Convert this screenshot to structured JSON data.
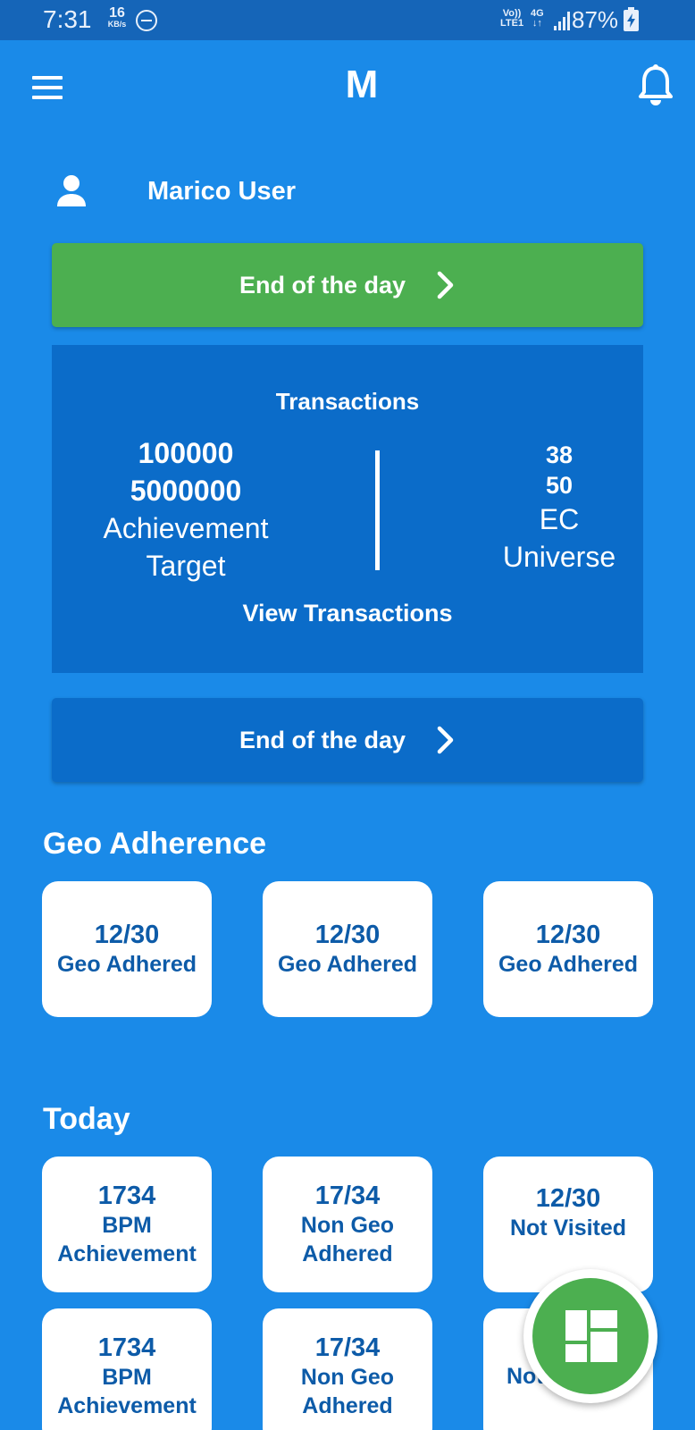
{
  "status_bar": {
    "time": "7:31",
    "speed_value": "16",
    "speed_unit": "KB/s",
    "volte_line1": "Vo))",
    "volte_line2": "LTE1",
    "network_line1": "4G",
    "network_line2": "↓↑",
    "battery": "87%",
    "icons": [
      "do-not-disturb-icon",
      "signal-icon",
      "battery-charging-icon"
    ]
  },
  "app_bar": {
    "logo": "M",
    "icons": [
      "menu-icon",
      "bell-icon"
    ]
  },
  "user": {
    "name": "Marico User",
    "icon": "user-icon"
  },
  "end_of_day_primary": {
    "label": "End of the day",
    "icon": "chevron-right-icon",
    "color": "#4caf50"
  },
  "transactions": {
    "title": "Transactions",
    "achievement_value": "100000",
    "target_value": "5000000",
    "achievement_label": "Achievement",
    "target_label": "Target",
    "ec_value": "38",
    "universe_value": "50",
    "ec_label": "EC",
    "universe_label": "Universe",
    "view_label": "View Transactions"
  },
  "end_of_day_secondary": {
    "label": "End of the day",
    "icon": "chevron-right-icon"
  },
  "geo_adherence": {
    "title": "Geo Adherence",
    "tiles": [
      {
        "value": "12/30",
        "caption": "Geo Adhered"
      },
      {
        "value": "12/30",
        "caption": "Geo Adhered"
      },
      {
        "value": "12/30",
        "caption": "Geo Adhered"
      }
    ]
  },
  "today": {
    "title": "Today",
    "tiles": [
      {
        "value": "1734",
        "caption1": "BPM",
        "caption2": "Achievement"
      },
      {
        "value": "17/34",
        "caption1": "Non Geo",
        "caption2": "Adhered"
      },
      {
        "value": "12/30",
        "caption1": "Not Visited",
        "caption2": ""
      },
      {
        "value": "1734",
        "caption1": "BPM",
        "caption2": "Achievement"
      },
      {
        "value": "17/34",
        "caption1": "Non Geo",
        "caption2": "Adhered"
      },
      {
        "value": "",
        "caption1": "Not",
        "caption2": ""
      }
    ]
  },
  "fab": {
    "icon": "dashboard-icon",
    "color": "#4caf50"
  },
  "colors": {
    "background": "#1a8ae8",
    "card": "#0b6cc9",
    "tile_text": "#0d5ba8",
    "status_bar": "#1565b8"
  }
}
